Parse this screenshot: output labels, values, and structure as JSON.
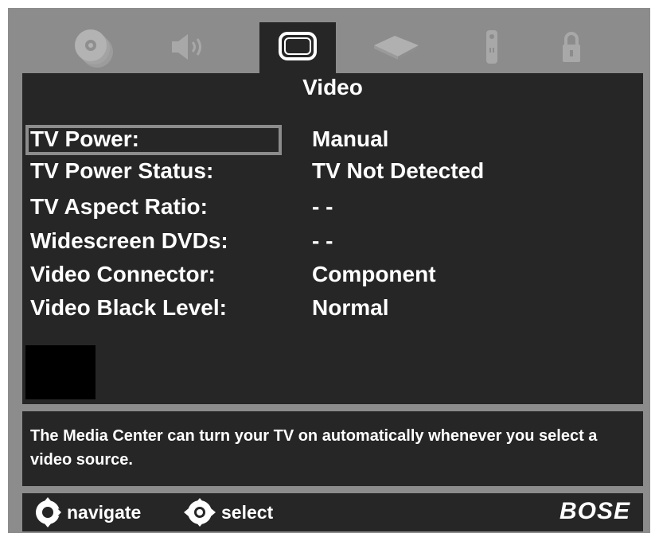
{
  "tabs": [
    {
      "icon": "disc-icon"
    },
    {
      "icon": "speaker-icon"
    },
    {
      "icon": "tv-icon",
      "active": true
    },
    {
      "icon": "media-box-icon"
    },
    {
      "icon": "remote-icon"
    },
    {
      "icon": "lock-icon"
    }
  ],
  "page": {
    "title": "Video"
  },
  "settings": [
    {
      "label": "TV Power:",
      "value": "Manual",
      "selected": true
    },
    {
      "label": "TV Power Status:",
      "value": "TV Not Detected"
    },
    {
      "label": "TV Aspect Ratio:",
      "value": "- -"
    },
    {
      "label": "Widescreen DVDs:",
      "value": "- -"
    },
    {
      "label": "Video Connector:",
      "value": "Component"
    },
    {
      "label": "Video Black Level:",
      "value": "Normal"
    }
  ],
  "help": {
    "text": "The Media Center can turn your TV on automatically whenever you select a video source."
  },
  "footer": {
    "navigate_label": "navigate",
    "select_label": "select",
    "brand": "BOSE"
  },
  "colors": {
    "frame": "#8c8c8c",
    "panel": "#262626",
    "text": "#ffffff",
    "inactive_icon": "#a6a6a6"
  }
}
